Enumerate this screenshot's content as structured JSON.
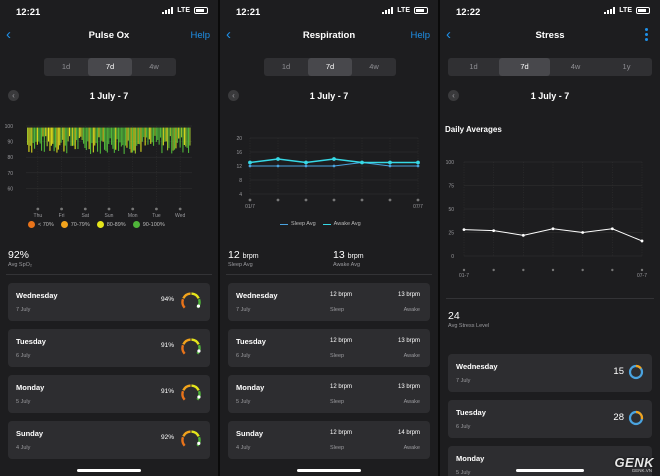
{
  "colors": {
    "accent": "#1e90e8",
    "sleep": "#4aa3df",
    "awake": "#36d9e6",
    "spo2_lt70": "#e8731a",
    "spo2_70_79": "#f2a31c",
    "spo2_80_89": "#e5e51b",
    "spo2_90_100": "#4fb43a"
  },
  "status": {
    "left_time": "12:21",
    "middle_time": "12:21",
    "right_time": "12:22",
    "network": "LTE"
  },
  "pulse": {
    "back_icon": "chevron-left-icon",
    "title": "Pulse Ox",
    "help": "Help",
    "tabs": [
      "1d",
      "7d",
      "4w"
    ],
    "date_range": "1 July - 7",
    "chart_data": {
      "type": "bar",
      "ylim": [
        50,
        100
      ],
      "y_ticks": [
        "100",
        "90",
        "80",
        "70",
        "60"
      ],
      "categories": [
        "Thu",
        "Fri",
        "Sat",
        "Sun",
        "Mon",
        "Tue",
        "Wed"
      ],
      "legend": [
        "< 70%",
        "70-79%",
        "80-89%",
        "90-100%"
      ],
      "grid": true
    },
    "avg_value": "92%",
    "avg_label": "Avg SpO₂",
    "days": [
      {
        "day": "Wednesday",
        "date": "7 July",
        "pct": "94%",
        "fraction": 0.94
      },
      {
        "day": "Tuesday",
        "date": "6 July",
        "pct": "91%",
        "fraction": 0.91
      },
      {
        "day": "Monday",
        "date": "5 July",
        "pct": "91%",
        "fraction": 0.91
      },
      {
        "day": "Sunday",
        "date": "4 July",
        "pct": "92%",
        "fraction": 0.92
      }
    ]
  },
  "resp": {
    "back_icon": "chevron-left-icon",
    "title": "Respiration",
    "help": "Help",
    "tabs": [
      "1d",
      "7d",
      "4w"
    ],
    "date_range": "1 July - 7",
    "chart_data": {
      "type": "line",
      "ylim": [
        4,
        20
      ],
      "y_ticks": [
        "20",
        "16",
        "12",
        "8",
        "4"
      ],
      "x_ticks": [
        "01/7",
        "07/7"
      ],
      "legend": [
        "Sleep Avg",
        "Awake Avg"
      ],
      "series": [
        {
          "name": "Sleep Avg",
          "values": [
            12,
            12,
            12,
            12,
            13,
            12,
            12
          ]
        },
        {
          "name": "Awake Avg",
          "values": [
            13,
            14,
            13,
            14,
            13,
            13,
            13
          ]
        }
      ],
      "grid": true
    },
    "sleep_value": "12",
    "sleep_unit": "brpm",
    "sleep_label": "Sleep Avg",
    "awake_value": "13",
    "awake_unit": "brpm",
    "awake_label": "Awake Avg",
    "days": [
      {
        "day": "Wednesday",
        "date": "7 July",
        "sleep": "12 brpm",
        "sleep_l": "Sleep",
        "awake": "13 brpm",
        "awake_l": "Awake"
      },
      {
        "day": "Tuesday",
        "date": "6 July",
        "sleep": "12 brpm",
        "sleep_l": "Sleep",
        "awake": "13 brpm",
        "awake_l": "Awake"
      },
      {
        "day": "Monday",
        "date": "5 July",
        "sleep": "12 brpm",
        "sleep_l": "Sleep",
        "awake": "13 brpm",
        "awake_l": "Awake"
      },
      {
        "day": "Sunday",
        "date": "4 July",
        "sleep": "12 brpm",
        "sleep_l": "Sleep",
        "awake": "14 brpm",
        "awake_l": "Awake"
      }
    ]
  },
  "stress": {
    "back_icon": "chevron-left-icon",
    "menu_icon": "more-vertical-icon",
    "title": "Stress",
    "tabs": [
      "1d",
      "7d",
      "4w",
      "1y"
    ],
    "date_range": "1 July - 7",
    "chart_heading": "Daily Averages",
    "chart_data": {
      "type": "line",
      "ylim": [
        0,
        100
      ],
      "y_ticks": [
        "100",
        "75",
        "50",
        "25",
        "0"
      ],
      "x_ticks": [
        "01-7",
        "07-7"
      ],
      "series": [
        {
          "values": [
            28,
            27,
            22,
            29,
            25,
            29,
            16
          ]
        }
      ],
      "grid": true
    },
    "avg_value": "24",
    "avg_label": "Avg Stress Level",
    "days": [
      {
        "day": "Wednesday",
        "date": "7 July",
        "value": "15",
        "fraction": 0.15
      },
      {
        "day": "Tuesday",
        "date": "6 July",
        "value": "28",
        "fraction": 0.28
      },
      {
        "day": "Monday",
        "date": "5 July"
      }
    ]
  },
  "watermark": {
    "logo": "GENK",
    "domain": "GENK.VN"
  }
}
